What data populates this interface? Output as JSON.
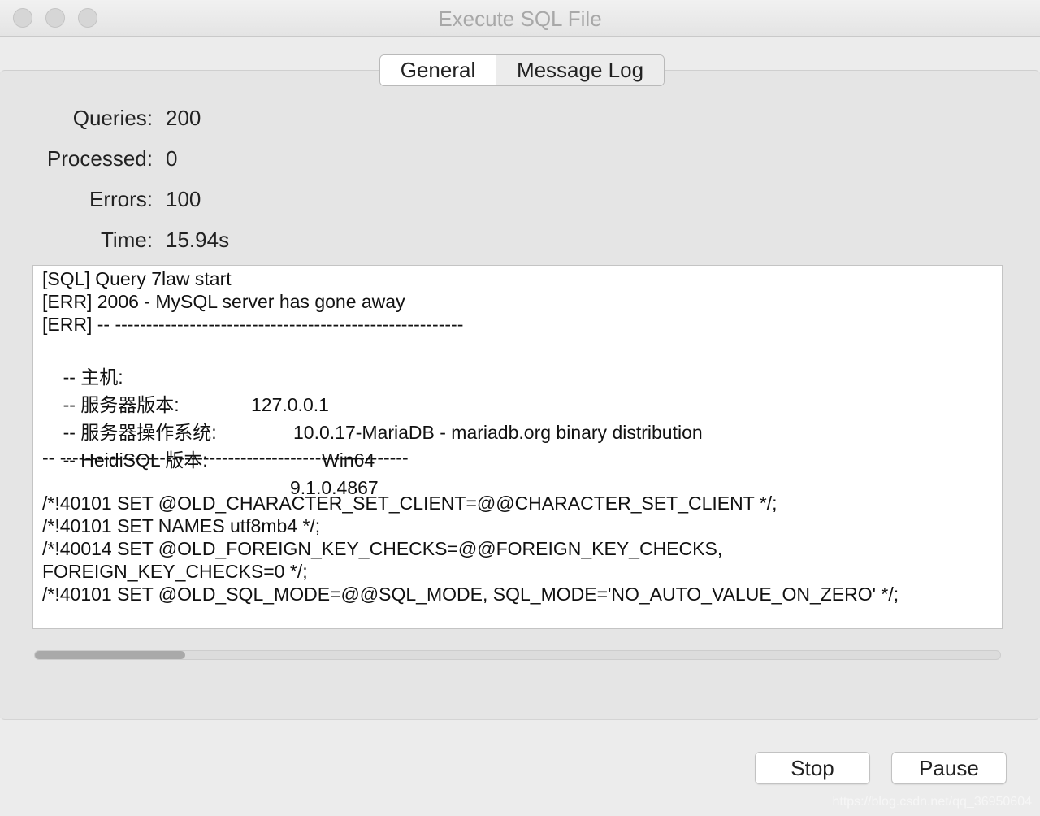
{
  "window": {
    "title": "Execute SQL File"
  },
  "tabs": [
    {
      "label": "General"
    },
    {
      "label": "Message Log"
    }
  ],
  "stats": {
    "queries_label": "Queries:",
    "queries_value": "200",
    "processed_label": "Processed:",
    "processed_value": "0",
    "errors_label": "Errors:",
    "errors_value": "100",
    "time_label": "Time:",
    "time_value": "15.94s"
  },
  "log": {
    "line1": "[SQL] Query 7law start",
    "line2": "[ERR] 2006 - MySQL server has gone away",
    "line3": "[ERR] -- --------------------------------------------------------",
    "cfg": [
      {
        "key": "-- 主机:",
        "value": "127.0.0.1"
      },
      {
        "key": "-- 服务器版本:",
        "value": "10.0.17-MariaDB - mariadb.org binary distribution"
      },
      {
        "key": "-- 服务器操作系统:",
        "value": "Win64"
      },
      {
        "key": "-- HeidiSQL 版本:",
        "value": "9.1.0.4867"
      }
    ],
    "divider": "-- --------------------------------------------------------",
    "sql1": "/*!40101 SET @OLD_CHARACTER_SET_CLIENT=@@CHARACTER_SET_CLIENT */;",
    "sql2": "/*!40101 SET NAMES utf8mb4 */;",
    "sql3": "/*!40014 SET @OLD_FOREIGN_KEY_CHECKS=@@FOREIGN_KEY_CHECKS,",
    "sql4": "FOREIGN_KEY_CHECKS=0 */;",
    "sql5": "/*!40101 SET @OLD_SQL_MODE=@@SQL_MODE, SQL_MODE='NO_AUTO_VALUE_ON_ZERO' */;"
  },
  "progress": {
    "fraction": 0.156
  },
  "buttons": {
    "stop": "Stop",
    "pause": "Pause"
  },
  "watermark": "https://blog.csdn.net/qq_36950604"
}
